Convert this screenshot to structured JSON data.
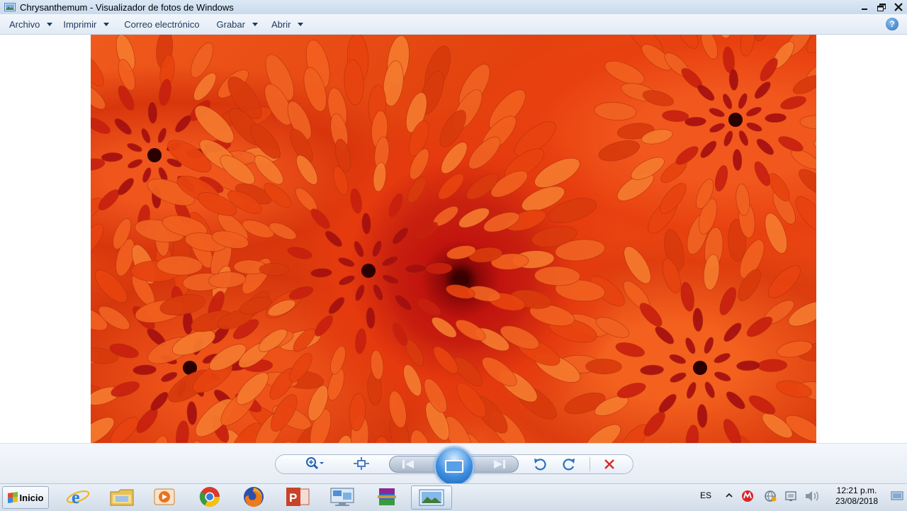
{
  "window": {
    "title": "Chrysanthemum - Visualizador de fotos de Windows"
  },
  "menu": {
    "items": [
      {
        "label": "Archivo",
        "has_dropdown": true
      },
      {
        "label": "Imprimir",
        "has_dropdown": true
      },
      {
        "label": "Correo electrónico",
        "has_dropdown": false
      },
      {
        "label": "Grabar",
        "has_dropdown": true
      },
      {
        "label": "Abrir",
        "has_dropdown": true
      }
    ],
    "help_label": "?"
  },
  "photo": {
    "subject": "chrysanthemum-flower",
    "colors": {
      "primary": "#e8430f",
      "center": "#8c0808",
      "highlight": "#f5651f"
    }
  },
  "controls": {
    "zoom_icon": "zoom-magnifier-icon",
    "fit_icon": "actual-size-icon",
    "prev_icon": "previous-icon",
    "slideshow_icon": "slideshow-icon",
    "next_icon": "next-icon",
    "rotate_ccw_icon": "rotate-counterclockwise-icon",
    "rotate_cw_icon": "rotate-clockwise-icon",
    "delete_icon": "delete-icon",
    "delete_color": "#d42a2a"
  },
  "taskbar": {
    "start_label": "Inicio",
    "apps": [
      {
        "name": "internet-explorer-icon"
      },
      {
        "name": "file-explorer-icon"
      },
      {
        "name": "media-player-icon"
      },
      {
        "name": "chrome-icon"
      },
      {
        "name": "firefox-icon"
      },
      {
        "name": "powerpoint-icon"
      },
      {
        "name": "remote-desktop-icon"
      },
      {
        "name": "winrar-icon"
      },
      {
        "name": "photo-viewer-icon",
        "active": true
      }
    ],
    "language": "ES",
    "clock_time": "12:21 p.m.",
    "clock_date": "23/08/2018"
  }
}
